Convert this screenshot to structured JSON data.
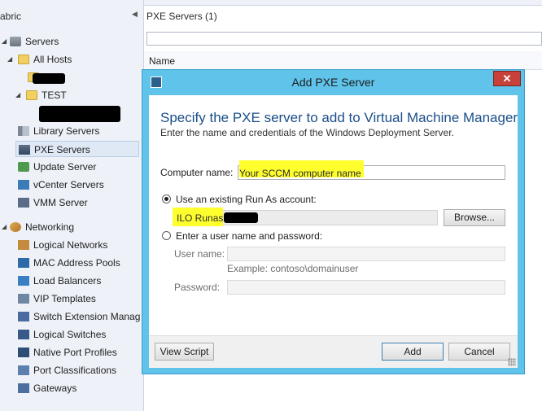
{
  "nav": {
    "title": "abric",
    "servers": "Servers",
    "all_hosts": "All Hosts",
    "test": "TEST",
    "library_servers": "Library Servers",
    "pxe_servers": "PXE Servers",
    "update_server": "Update Server",
    "vcenter_servers": "vCenter Servers",
    "vmm_server": "VMM Server",
    "networking": "Networking",
    "logical_networks": "Logical Networks",
    "mac_address_pools": "MAC Address Pools",
    "load_balancers": "Load Balancers",
    "vip_templates": "VIP Templates",
    "switch_extension": "Switch Extension Manag",
    "logical_switches": "Logical Switches",
    "native_port_profiles": "Native Port Profiles",
    "port_classifications": "Port Classifications",
    "gateways": "Gateways"
  },
  "main": {
    "title": "PXE Servers (1)",
    "column_name": "Name"
  },
  "dialog": {
    "title": "Add PXE Server",
    "close_glyph": "✕",
    "heading": "Specify the PXE server to add to Virtual Machine Manager",
    "subheading": "Enter the name and credentials of the Windows Deployment Server.",
    "computer_name_label": "Computer name:",
    "computer_name_value": "Your SCCM computer name",
    "runas_option_label": "Use an existing Run As account:",
    "runas_value": "ILO Runas",
    "browse_label": "Browse...",
    "userpass_option_label": "Enter a user name and password:",
    "username_label": "User name:",
    "username_example": "Example: contoso\\domainuser",
    "password_label": "Password:",
    "view_script_label": "View Script",
    "add_label": "Add",
    "cancel_label": "Cancel"
  },
  "colors": {
    "dialog_chrome": "#5fc3ea",
    "highlight": "#ffff2e",
    "heading_blue": "#1a4f8a",
    "close_red": "#c8403a"
  }
}
